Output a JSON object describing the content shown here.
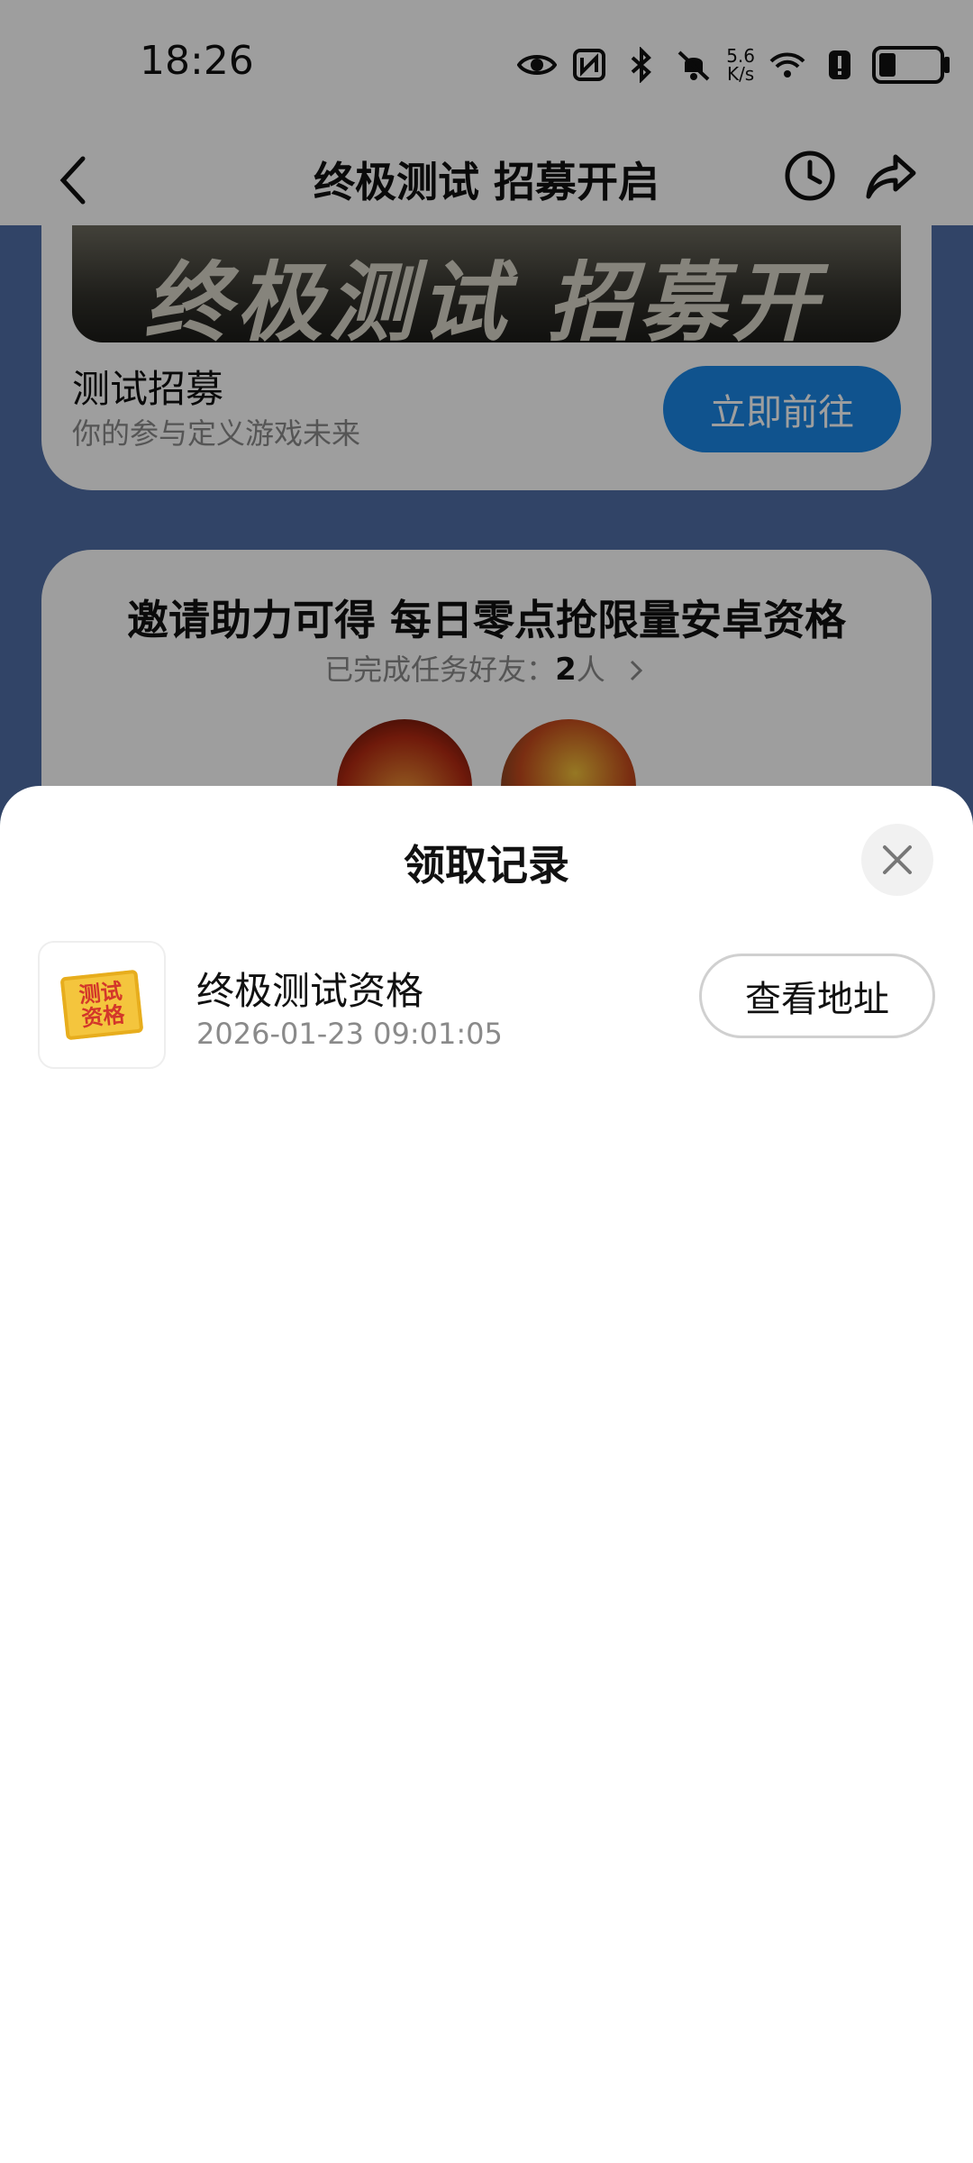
{
  "status_bar": {
    "time": "18:26",
    "network_speed_value": "5.6",
    "network_speed_unit": "K/s",
    "icons": [
      "eye-icon",
      "nfc-icon",
      "bluetooth-icon",
      "mute-bell-icon",
      "wifi-icon",
      "alert-icon",
      "battery-icon"
    ]
  },
  "nav": {
    "title": "终极测试 招募开启",
    "icons": [
      "back-icon",
      "history-clock-icon",
      "share-icon"
    ]
  },
  "banner": {
    "image_text": "终极测试 招募开启",
    "recruit_title": "测试招募",
    "recruit_subtitle": "你的参与定义游戏未来",
    "go_button": "立即前往"
  },
  "invite": {
    "title": "邀请助力可得 每日零点抢限量安卓资格",
    "completed_label": "已完成任务好友：",
    "completed_count": "2",
    "completed_unit": "人"
  },
  "sheet": {
    "title": "领取记录",
    "records": [
      {
        "thumb_text": "测试资格",
        "name": "终极测试资格",
        "time": "2026-01-23 09:01:05",
        "action": "查看地址"
      }
    ]
  },
  "colors": {
    "accent": "#1a87e6",
    "page_background": "#4f6ea6"
  }
}
